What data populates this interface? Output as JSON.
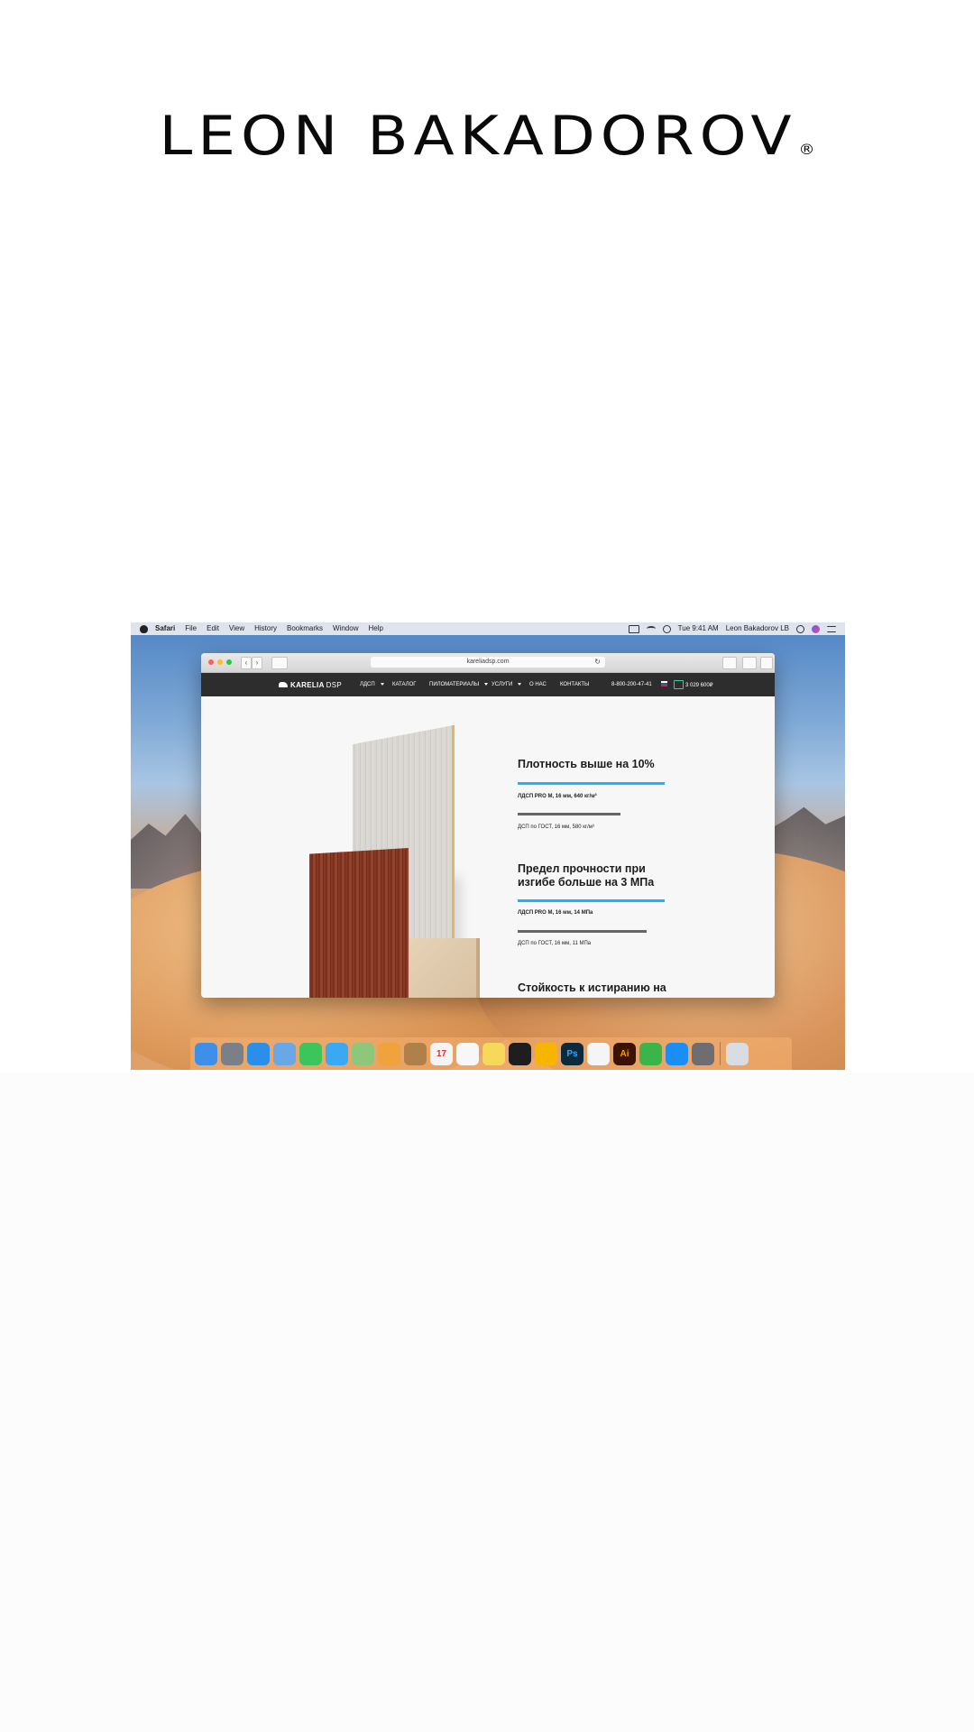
{
  "brand": {
    "name": "LEON BAKADOROV",
    "registered_mark": "®"
  },
  "menubar": {
    "items": [
      "Safari",
      "File",
      "Edit",
      "View",
      "History",
      "Bookmarks",
      "Window",
      "Help"
    ],
    "clock": "Tue 9:41 AM",
    "user": "Leon Bakadorov LB"
  },
  "browser": {
    "url": "kareliadsp.com",
    "reload_glyph": "↻",
    "back_glyph": "‹",
    "forward_glyph": "›"
  },
  "site": {
    "logo_bold": "KARELIA",
    "logo_thin": "DSP",
    "nav": [
      "ЛДСП",
      "КАТАЛОГ",
      "ПИЛОМАТЕРИАЛЫ",
      "УСЛУГИ",
      "О НАС",
      "КОНТАКТЫ"
    ],
    "phone": "8-800-200-47-41",
    "cart_total": "3 029 600₽"
  },
  "stats": [
    {
      "title": "Плотность выше на 10%",
      "pro_label": "ЛДСП PRO M, 16 мм, 640 кг/м³",
      "gost_label": "ДСП по ГОСТ, 16 мм, 580 кг/м³",
      "pro_fraction": 1.0,
      "gost_fraction": 0.7
    },
    {
      "title_line1": "Предел прочности при",
      "title_line2": "изгибе больше на 3 МПа",
      "pro_label": "ЛДСП PRO M, 16 мм, 14 МПа",
      "gost_label": "ДСП по ГОСТ, 16 мм, 11 МПа",
      "pro_fraction": 1.0,
      "gost_fraction": 0.88
    },
    {
      "title": "Стойкость к истиранию на"
    }
  ],
  "dock": {
    "icons": [
      {
        "name": "finder-icon",
        "glyph": "",
        "color": "#3d8fe8"
      },
      {
        "name": "launchpad-icon",
        "glyph": "",
        "color": "#7a7f88"
      },
      {
        "name": "safari-icon",
        "glyph": "",
        "color": "#2a8fe8"
      },
      {
        "name": "mail-icon",
        "glyph": "",
        "color": "#6aa7e6"
      },
      {
        "name": "facetime-icon",
        "glyph": "",
        "color": "#3bc55a"
      },
      {
        "name": "messages-icon",
        "glyph": "",
        "color": "#3aa8f3"
      },
      {
        "name": "maps-icon",
        "glyph": "",
        "color": "#8fc77a"
      },
      {
        "name": "photos-icon",
        "glyph": "",
        "color": "#f0a33a"
      },
      {
        "name": "contacts-icon",
        "glyph": "",
        "color": "#b0804a"
      },
      {
        "name": "calendar-icon",
        "glyph": "17",
        "color": "#f4f4f4"
      },
      {
        "name": "reminders-icon",
        "glyph": "",
        "color": "#f7f7f7"
      },
      {
        "name": "notes-icon",
        "glyph": "",
        "color": "#f6d85a"
      },
      {
        "name": "figma-icon",
        "glyph": "",
        "color": "#1e1e1e"
      },
      {
        "name": "sketch-icon",
        "glyph": "",
        "color": "#f7b500"
      },
      {
        "name": "photoshop-icon",
        "glyph": "Ps",
        "color": "#0c2a3c"
      },
      {
        "name": "itunes-icon",
        "glyph": "",
        "color": "#f5f5f5"
      },
      {
        "name": "illustrator-icon",
        "glyph": "Ai",
        "color": "#3a1400"
      },
      {
        "name": "numbers-icon",
        "glyph": "",
        "color": "#3bb54a"
      },
      {
        "name": "appstore-icon",
        "glyph": "",
        "color": "#1a8ef5"
      },
      {
        "name": "system-preferences-icon",
        "glyph": "",
        "color": "#6d6d72"
      }
    ],
    "trash": {
      "name": "trash-icon",
      "glyph": "",
      "color": "#d9dde2"
    }
  }
}
